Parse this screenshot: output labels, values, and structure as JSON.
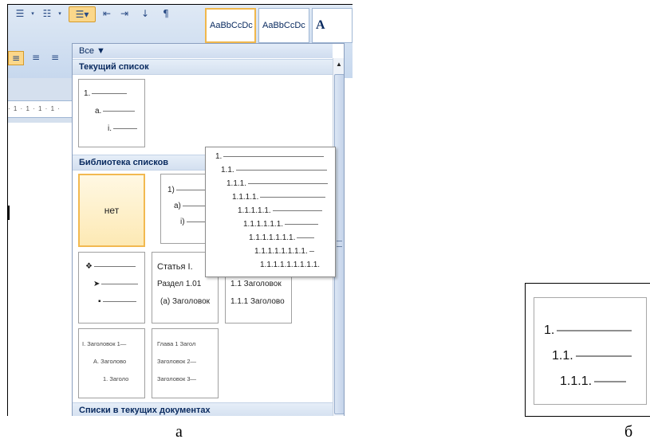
{
  "ribbon": {
    "style_sample_1": "AaBbCcDc",
    "style_sample_2": "AaBbCcDc",
    "style_sample_3": "A"
  },
  "ruler": {
    "marks": "· 1 · 1 · 1 · 1 ·"
  },
  "dropdown": {
    "filter_label": "Все ▼",
    "section_current": "Текущий список",
    "section_library": "Библиотека списков",
    "section_documents": "Списки в текущих документах",
    "current_list": [
      "1.",
      "a.",
      "i."
    ],
    "tile_none": "нет",
    "tile_parenthesis": [
      "1)",
      "a)",
      "i)"
    ],
    "tile_bullets": [
      "❖",
      "➤",
      "▪"
    ],
    "tile_article": [
      "Статья I.",
      "Раздел 1.01",
      "(a) Заголовок"
    ],
    "tile_heading_numbers": [
      "1.1 Заголовок",
      "1.1.1 Заголово"
    ],
    "tile_roman": [
      "I. Заголовок 1—",
      "A. Заголово",
      "1. Заголо"
    ],
    "tile_chapter": [
      "Глава 1 Загол",
      "Заголовок 2—",
      "Заголовок 3—"
    ]
  },
  "tooltip": {
    "levels": [
      "1.",
      "1.1.",
      "1.1.1.",
      "1.1.1.1.",
      "1.1.1.1.1.",
      "1.1.1.1.1.1.",
      "1.1.1.1.1.1.1.",
      "1.1.1.1.1.1.1.1.",
      "1.1.1.1.1.1.1.1.1."
    ]
  },
  "panel_b": {
    "levels": [
      "1.",
      "1.1.",
      "1.1.1."
    ]
  },
  "captions": {
    "a": "а",
    "b": "б"
  },
  "icons": {
    "bullets": "bullet-list-icon",
    "numbering": "numbered-list-icon",
    "multilevel": "multilevel-list-icon",
    "indent": "indent-icon",
    "sort": "sort-icon",
    "pilcrow": "pilcrow-icon"
  },
  "colors": {
    "highlight": "#fbd78a",
    "selected_border": "#f2b950",
    "header_text": "#0a2b60"
  }
}
